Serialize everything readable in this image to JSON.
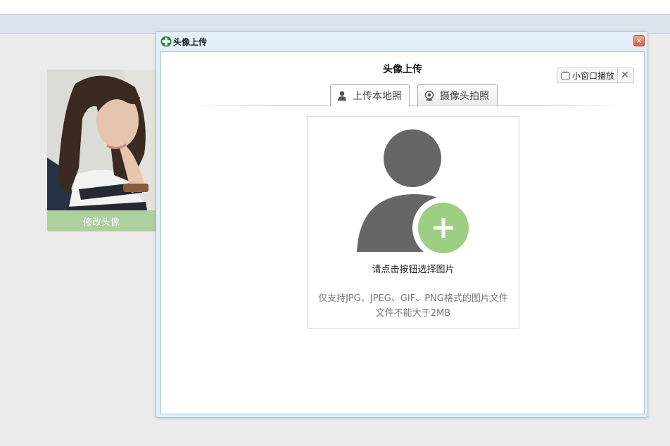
{
  "profile": {
    "edit_avatar_label": "修改头像"
  },
  "dialog": {
    "title": "头像上传",
    "title_icon": "green-plus-icon",
    "close_icon": "close-icon",
    "heading": "头像上传"
  },
  "mini_player": {
    "label": "小窗口播放",
    "icon": "tv-icon",
    "close_icon": "close-icon"
  },
  "tabs": [
    {
      "label": "上传本地照",
      "icon": "user-icon",
      "active": true
    },
    {
      "label": "摄像头拍照",
      "icon": "webcam-icon",
      "active": false
    }
  ],
  "upload": {
    "hint": "请点击按钮选择图片",
    "support_line1": "仅支持JPG、JPEG、GIF、PNG格式的图片文件",
    "support_line2": "文件不能大于2MB",
    "icon": "add-user-icon"
  },
  "colors": {
    "accent_green": "#9ccf81",
    "avatar_button_bg": "#acd19e",
    "dialog_border": "#a9c4e4",
    "icon_gray": "#666666"
  }
}
